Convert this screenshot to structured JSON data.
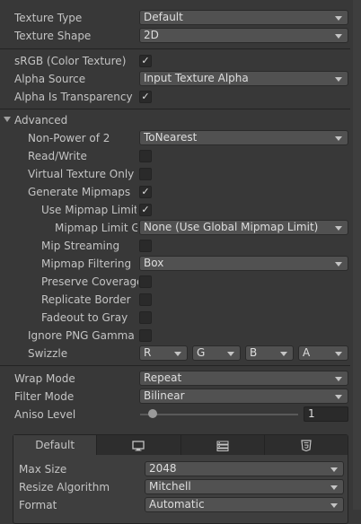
{
  "texture_type": {
    "label": "Texture Type",
    "value": "Default"
  },
  "texture_shape": {
    "label": "Texture Shape",
    "value": "2D"
  },
  "srgb": {
    "label": "sRGB (Color Texture)",
    "checked": true
  },
  "alpha_source": {
    "label": "Alpha Source",
    "value": "Input Texture Alpha"
  },
  "alpha_is_transparency": {
    "label": "Alpha Is Transparency",
    "checked": true
  },
  "advanced": {
    "label": "Advanced",
    "non_power_of_2": {
      "label": "Non-Power of 2",
      "value": "ToNearest"
    },
    "read_write": {
      "label": "Read/Write",
      "checked": false
    },
    "virtual_texture_only": {
      "label": "Virtual Texture Only",
      "checked": false
    },
    "generate_mipmaps": {
      "label": "Generate Mipmaps",
      "checked": true
    },
    "use_mipmap_limits": {
      "label": "Use Mipmap Limits",
      "checked": true
    },
    "mipmap_limit_group": {
      "label": "Mipmap Limit Gr",
      "value": "None (Use Global Mipmap Limit)"
    },
    "mip_streaming": {
      "label": "Mip Streaming",
      "checked": false
    },
    "mipmap_filtering": {
      "label": "Mipmap Filtering",
      "value": "Box"
    },
    "preserve_coverage": {
      "label": "Preserve Coverage",
      "checked": false
    },
    "replicate_border": {
      "label": "Replicate Border",
      "checked": false
    },
    "fadeout_to_gray": {
      "label": "Fadeout to Gray",
      "checked": false
    },
    "ignore_png_gamma": {
      "label": "Ignore PNG Gamma",
      "checked": false
    },
    "swizzle": {
      "label": "Swizzle",
      "values": [
        "R",
        "G",
        "B",
        "A"
      ]
    }
  },
  "wrap_mode": {
    "label": "Wrap Mode",
    "value": "Repeat"
  },
  "filter_mode": {
    "label": "Filter Mode",
    "value": "Bilinear"
  },
  "aniso_level": {
    "label": "Aniso Level",
    "value": "1",
    "level_fraction": 0.08
  },
  "platform_panel": {
    "tabs": [
      {
        "label": "Default",
        "icon": ""
      },
      {
        "label": "",
        "icon": "monitor-icon"
      },
      {
        "label": "",
        "icon": "server-icon"
      },
      {
        "label": "",
        "icon": "html5-icon"
      }
    ],
    "max_size": {
      "label": "Max Size",
      "value": "2048"
    },
    "resize_algorithm": {
      "label": "Resize Algorithm",
      "value": "Mitchell"
    },
    "format": {
      "label": "Format",
      "value": "Automatic"
    }
  }
}
